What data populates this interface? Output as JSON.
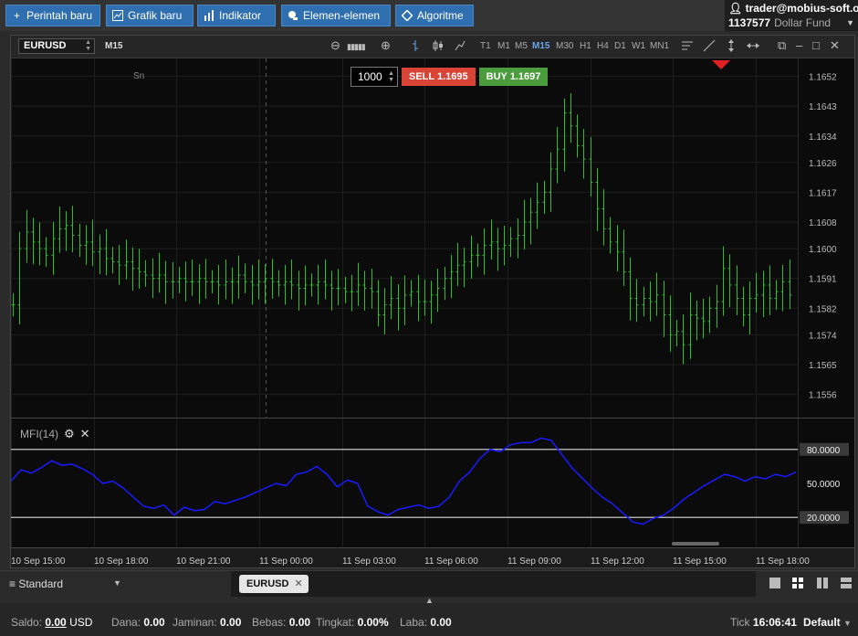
{
  "toolbar": {
    "buttons": [
      {
        "label": "Perintah baru",
        "icon": "plus-icon"
      },
      {
        "label": "Grafik baru",
        "icon": "chart-icon"
      },
      {
        "label": "Indikator",
        "icon": "bar-icon"
      },
      {
        "label": "Elemen-elemen",
        "icon": "elements-icon"
      },
      {
        "label": "Algoritme",
        "icon": "diamond-icon"
      }
    ]
  },
  "account": {
    "email": "trader@mobius-soft.org",
    "number": "1137577",
    "fund": "Dollar Fund"
  },
  "chart_header": {
    "symbol": "EURUSD",
    "timeframe": "M15",
    "timeframes": [
      "T1",
      "M1",
      "M5",
      "M15",
      "M30",
      "H1",
      "H4",
      "D1",
      "W1",
      "MN1"
    ],
    "active_timeframe": "M15"
  },
  "order": {
    "quantity": "1000",
    "sell_label": "SELL",
    "sell_price": "1.1695",
    "buy_label": "BUY",
    "buy_price": "1.1697"
  },
  "session_label": "Sn",
  "indicator": {
    "label": "MFI(14)",
    "levels": [
      "80.0000",
      "50.0000",
      "20.0000"
    ]
  },
  "chart_data": [
    {
      "type": "bar",
      "subtype": "ohlc",
      "yticks": [
        "1.1652",
        "1.1643",
        "1.1634",
        "1.1626",
        "1.1617",
        "1.1608",
        "1.1600",
        "1.1591",
        "1.1582",
        "1.1574",
        "1.1565",
        "1.1556"
      ],
      "ylim": [
        1.1549,
        1.1656
      ],
      "color": "#27c327",
      "closes": [
        1.1583,
        1.16,
        1.1605,
        1.1602,
        1.16,
        1.1598,
        1.1603,
        1.1606,
        1.1607,
        1.1604,
        1.1601,
        1.1602,
        1.1599,
        1.16,
        1.1597,
        1.1596,
        1.1595,
        1.1596,
        1.1594,
        1.1593,
        1.1592,
        1.1591,
        1.1592,
        1.159,
        1.159,
        1.1591,
        1.159,
        1.159,
        1.1591,
        1.159,
        1.159,
        1.1589,
        1.159,
        1.159,
        1.1592,
        1.159,
        1.1589,
        1.159,
        1.1591,
        1.159,
        1.1589,
        1.159,
        1.1589,
        1.1588,
        1.1589,
        1.1589,
        1.159,
        1.1589,
        1.1588,
        1.1588,
        1.1587,
        1.1587,
        1.1589,
        1.1588,
        1.1587,
        1.158,
        1.1583,
        1.1585,
        1.1582,
        1.1586,
        1.1587,
        1.1584,
        1.1584,
        1.1586,
        1.1588,
        1.1591,
        1.1593,
        1.1595,
        1.1596,
        1.1598,
        1.1598,
        1.1601,
        1.1602,
        1.16,
        1.1601,
        1.1603,
        1.1604,
        1.1608,
        1.1611,
        1.1614,
        1.1617,
        1.1624,
        1.163,
        1.1641,
        1.1637,
        1.1631,
        1.1627,
        1.162,
        1.1612,
        1.1606,
        1.1602,
        1.1599,
        1.1593,
        1.1585,
        1.1583,
        1.1585,
        1.1584,
        1.1586,
        1.158,
        1.1574,
        1.1575,
        1.1571,
        1.158,
        1.1579,
        1.1578,
        1.1582,
        1.1584,
        1.1594,
        1.1589,
        1.1585,
        1.158,
        1.1585,
        1.1586,
        1.1589,
        1.1585,
        1.1587,
        1.159,
        1.1586
      ]
    },
    {
      "type": "line",
      "name": "MFI(14)",
      "ylim": [
        0,
        100
      ],
      "color": "#1a1aff",
      "values": [
        52,
        62,
        59,
        64,
        70,
        66,
        67,
        63,
        58,
        50,
        52,
        46,
        38,
        30,
        28,
        31,
        22,
        29,
        26,
        27,
        34,
        32,
        35,
        38,
        42,
        46,
        50,
        48,
        58,
        60,
        65,
        58,
        47,
        53,
        50,
        30,
        25,
        22,
        27,
        29,
        31,
        28,
        30,
        38,
        52,
        60,
        72,
        80,
        78,
        84,
        86,
        86,
        90,
        88,
        76,
        64,
        55,
        46,
        38,
        32,
        24,
        16,
        14,
        19,
        22,
        28,
        36,
        42,
        48,
        53,
        58,
        56,
        52,
        56,
        54,
        58,
        56,
        60
      ]
    },
    {
      "type": "axis",
      "xticks": [
        "10 Sep 15:00",
        "10 Sep 18:00",
        "10 Sep 21:00",
        "11 Sep 00:00",
        "11 Sep 03:00",
        "11 Sep 06:00",
        "11 Sep 09:00",
        "11 Sep 12:00",
        "11 Sep 15:00",
        "11 Sep 18:00"
      ]
    }
  ],
  "bottom": {
    "template": "Standard",
    "tab": "EURUSD"
  },
  "status": {
    "saldo_label": "Saldo:",
    "saldo": "0.00",
    "currency": "USD",
    "dana_label": "Dana:",
    "dana": "0.00",
    "jaminan_label": "Jaminan:",
    "jaminan": "0.00",
    "bebas_label": "Bebas:",
    "bebas": "0.00",
    "tingkat_label": "Tingkat:",
    "tingkat": "0.00%",
    "laba_label": "Laba:",
    "laba": "0.00",
    "tick_label": "Tick",
    "tick": "16:06:41",
    "profile": "Default"
  }
}
